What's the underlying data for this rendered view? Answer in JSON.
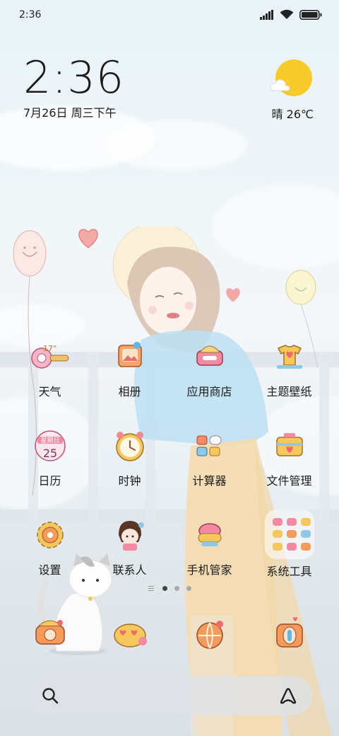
{
  "status_bar": {
    "time": "2:36",
    "icons": [
      "signal-icon",
      "wifi-icon",
      "battery-icon"
    ]
  },
  "clock_widget": {
    "time": "2:36",
    "date": "7月26日 周三下午"
  },
  "weather_widget": {
    "text": "晴 26℃",
    "icon": "sunny-cloud-icon",
    "sun_color": "#f7cc2a"
  },
  "apps": [
    {
      "label": "天气",
      "icon": "weather-app-icon"
    },
    {
      "label": "相册",
      "icon": "gallery-app-icon"
    },
    {
      "label": "应用商店",
      "icon": "app-store-icon"
    },
    {
      "label": "主题壁纸",
      "icon": "themes-icon"
    },
    {
      "label": "日历",
      "icon": "calendar-app-icon",
      "icon_text_top": "星期日",
      "icon_text_num": "25"
    },
    {
      "label": "时钟",
      "icon": "clock-app-icon"
    },
    {
      "label": "计算器",
      "icon": "calculator-app-icon"
    },
    {
      "label": "文件管理",
      "icon": "file-manager-icon"
    },
    {
      "label": "设置",
      "icon": "settings-app-icon"
    },
    {
      "label": "联系人",
      "icon": "contacts-app-icon"
    },
    {
      "label": "手机管家",
      "icon": "security-app-icon"
    },
    {
      "label": "系统工具",
      "icon": "system-tools-folder-icon"
    }
  ],
  "weather_icon_text": "17°",
  "page_indicator": {
    "pages": 3,
    "active": 1
  },
  "dock": [
    {
      "icon": "phone-app-icon"
    },
    {
      "icon": "messages-app-icon"
    },
    {
      "icon": "browser-app-icon"
    },
    {
      "icon": "camera-app-icon"
    }
  ],
  "search_bar": {
    "left_icon": "search-icon",
    "right_icon": "assistant-icon"
  }
}
